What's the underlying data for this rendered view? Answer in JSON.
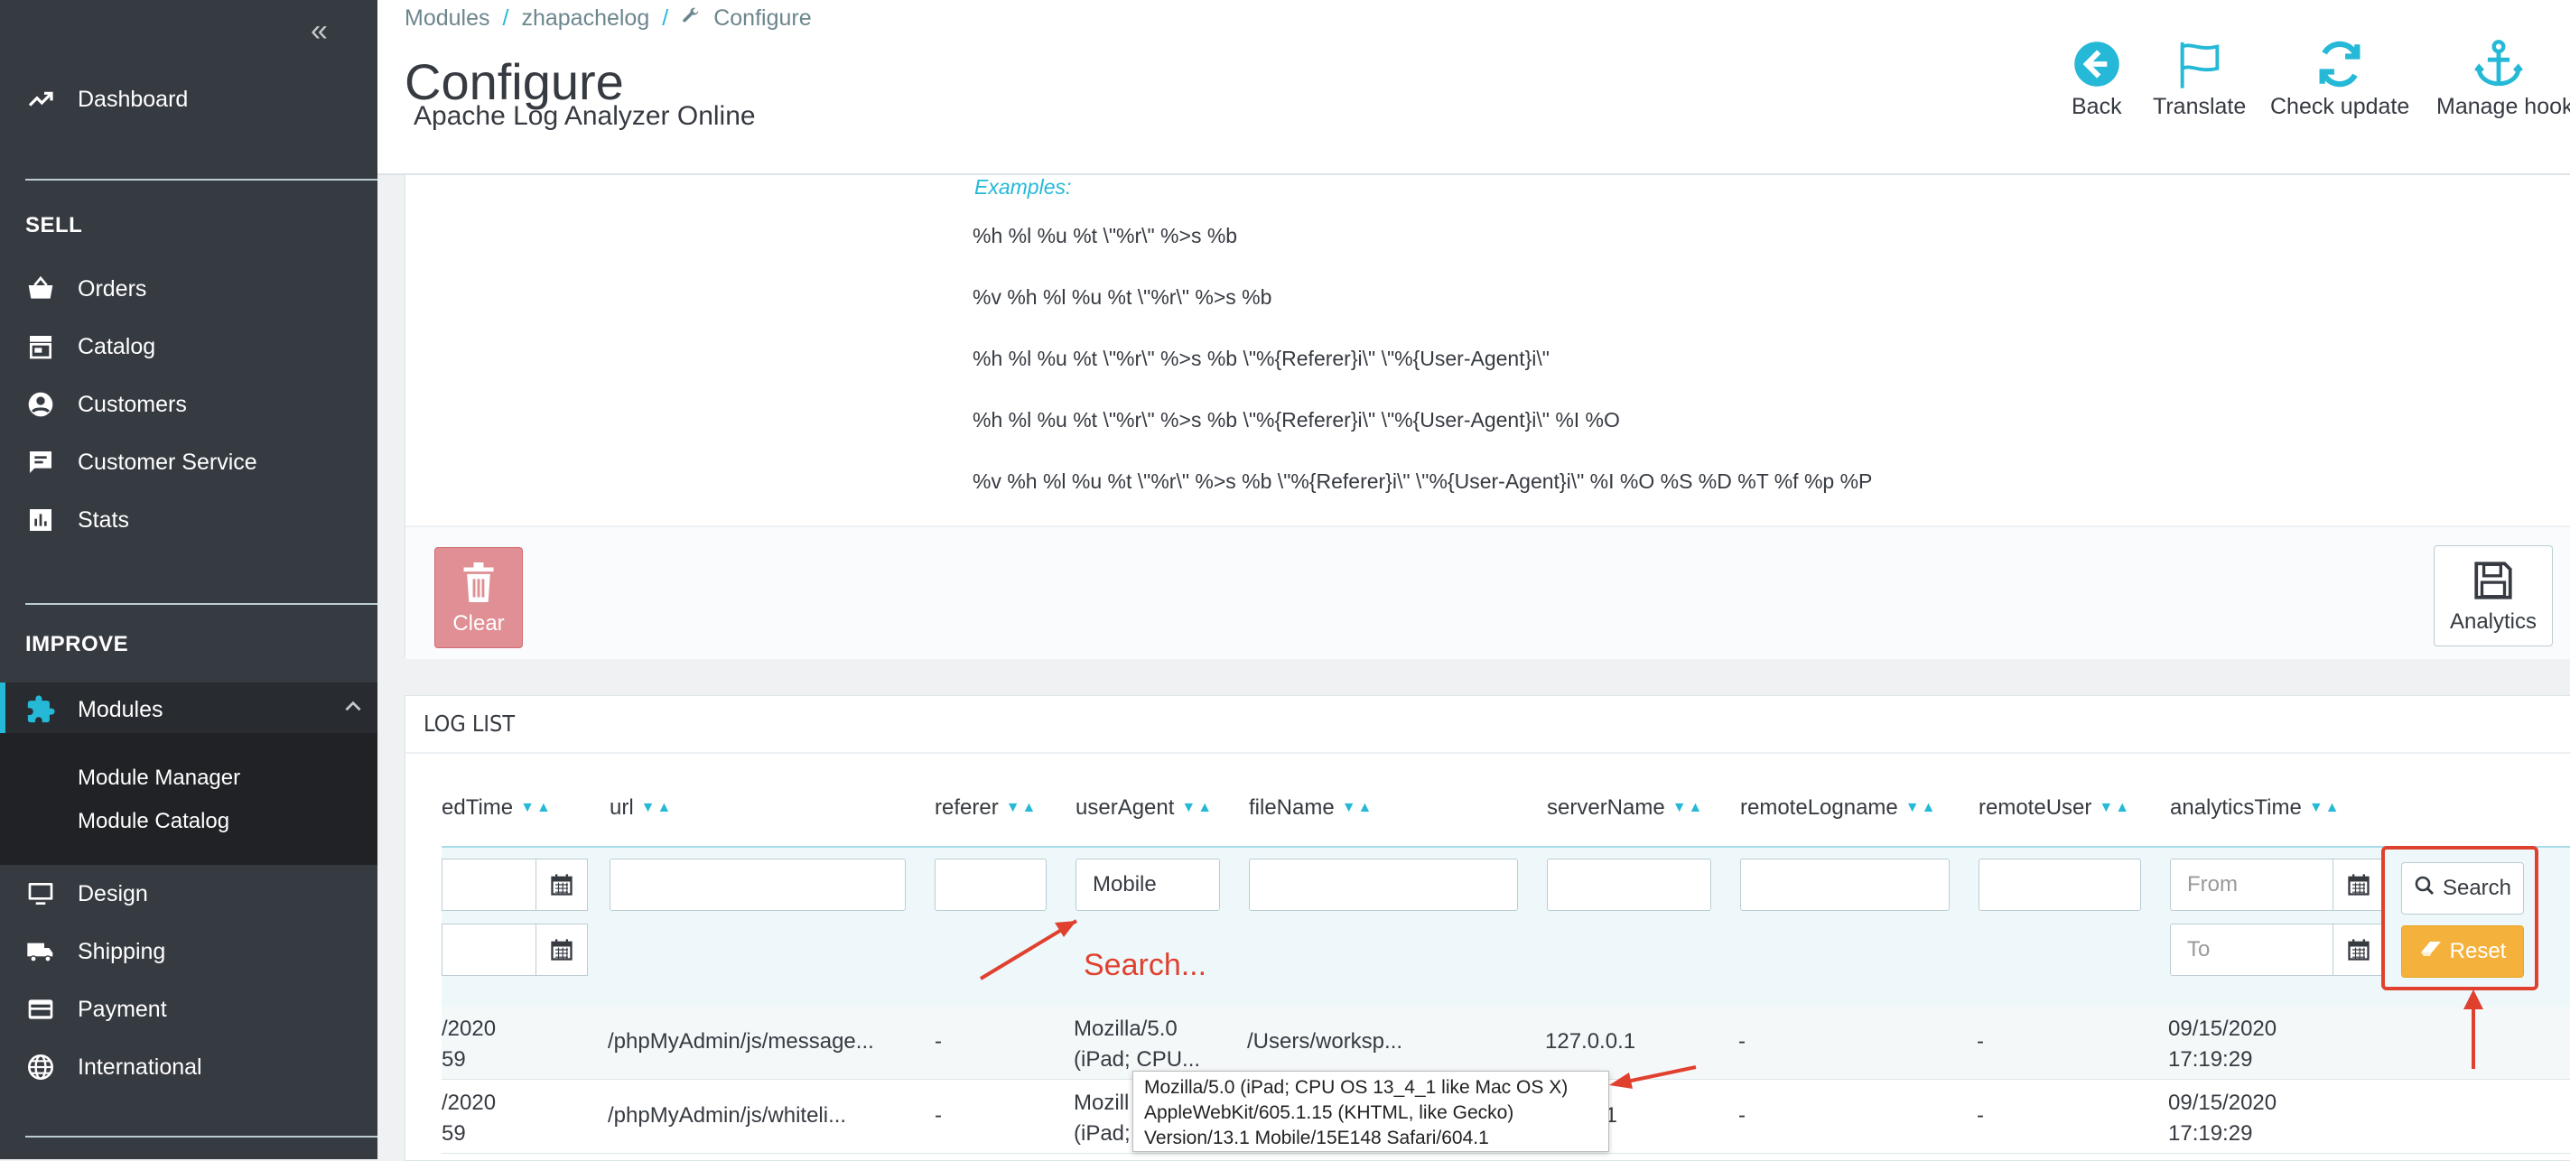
{
  "sidebar": {
    "dashboard": "Dashboard",
    "sell_title": "SELL",
    "sell_items": [
      "Orders",
      "Catalog",
      "Customers",
      "Customer Service",
      "Stats"
    ],
    "improve_title": "IMPROVE",
    "modules": "Modules",
    "module_sub": [
      "Module Manager",
      "Module Catalog"
    ],
    "improve_items": [
      "Design",
      "Shipping",
      "Payment",
      "International"
    ]
  },
  "breadcrumb": {
    "items": [
      "Modules",
      "zhapachelog",
      "Configure"
    ],
    "separator": "/"
  },
  "header": {
    "title": "Configure",
    "subtitle": "Apache Log Analyzer Online",
    "toolbar": [
      "Back",
      "Translate",
      "Check update",
      "Manage hook"
    ]
  },
  "config_panel": {
    "examples_label": "Examples:",
    "examples": [
      "%h %l %u %t \\\"%r\\\" %>s %b",
      "%v %h %l %u %t \\\"%r\\\" %>s %b",
      "%h %l %u %t \\\"%r\\\" %>s %b \\\"%{Referer}i\\\" \\\"%{User-Agent}i\\\"",
      "%h %l %u %t \\\"%r\\\" %>s %b \\\"%{Referer}i\\\" \\\"%{User-Agent}i\\\" %I %O",
      "%v %h %l %u %t \\\"%r\\\" %>s %b \\\"%{Referer}i\\\" \\\"%{User-Agent}i\\\" %I %O %S %D %T %f %p %P"
    ],
    "clear_label": "Clear",
    "analytics_label": "Analytics"
  },
  "log_list": {
    "title": "LOG LIST",
    "columns": [
      "edTime",
      "url",
      "referer",
      "userAgent",
      "fileName",
      "serverName",
      "remoteLogname",
      "remoteUser",
      "analyticsTime"
    ],
    "filters": {
      "userAgent_value": "Mobile",
      "from_placeholder": "From",
      "to_placeholder": "To"
    },
    "search_label": "Search",
    "reset_label": "Reset",
    "rows": [
      {
        "time": "/2020\n59",
        "url": "/phpMyAdmin/js/message...",
        "referer": "-",
        "userAgent": "Mozilla/5.0\n(iPad; CPU...",
        "fileName": "/Users/worksp...",
        "serverName": "127.0.0.1",
        "remoteLogname": "-",
        "remoteUser": "-",
        "analyticsTime": "09/15/2020\n17:19:29"
      },
      {
        "time": "/2020\n59",
        "url": "/phpMyAdmin/js/whiteli...",
        "referer": "-",
        "userAgent": "Mozill\n(iPad;",
        "fileName": "",
        "serverName": ".0.1",
        "remoteLogname": "-",
        "remoteUser": "-",
        "analyticsTime": "09/15/2020\n17:19:29"
      }
    ],
    "tooltip": [
      "Mozilla/5.0 (iPad; CPU OS 13_4_1 like Mac OS X)",
      "AppleWebKit/605.1.15 (KHTML, like Gecko)",
      "Version/13.1 Mobile/15E148 Safari/604.1"
    ]
  },
  "annotation": {
    "search_hint": "Search..."
  },
  "colors": {
    "sidebar": "#363a41",
    "accent": "#25b9d7",
    "clear": "#e08f95",
    "reset": "#f4b23c",
    "annotation": "#e0412f"
  }
}
